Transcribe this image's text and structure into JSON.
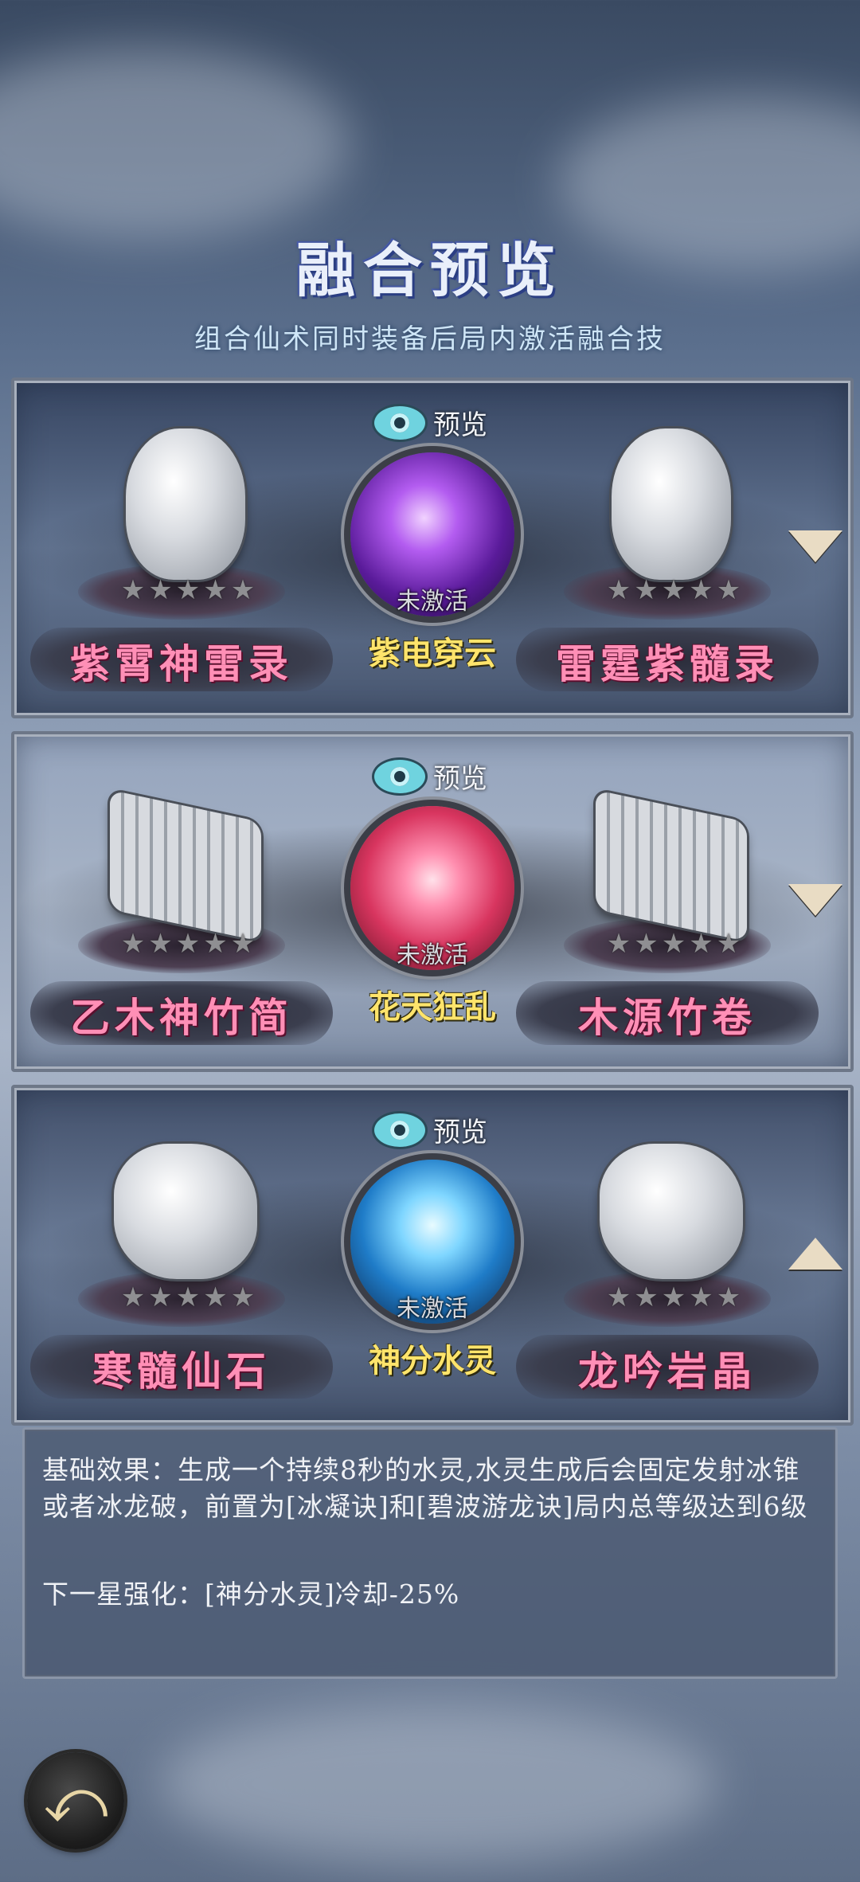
{
  "header": {
    "title": "融合预览",
    "subtitle": "组合仙术同时装备后局内激活融合技"
  },
  "fusions": [
    {
      "left": {
        "name": "紫霄神雷录",
        "stars": 5,
        "icon": "thunder-talisman-icon"
      },
      "right": {
        "name": "雷霆紫髓录",
        "stars": 5,
        "icon": "thunder-talisman-icon"
      },
      "preview_label": "预览",
      "status": "未激活",
      "fusion_name": "紫电穿云",
      "orb_color": "#7a2fd0",
      "toggle": "collapse"
    },
    {
      "left": {
        "name": "乙木神竹简",
        "stars": 5,
        "icon": "bamboo-scroll-icon"
      },
      "right": {
        "name": "木源竹卷",
        "stars": 5,
        "icon": "bamboo-scroll-icon"
      },
      "preview_label": "预览",
      "status": "未激活",
      "fusion_name": "花天狂乱",
      "orb_color": "#e0406a",
      "toggle": "collapse"
    },
    {
      "left": {
        "name": "寒髓仙石",
        "stars": 5,
        "icon": "ice-stone-icon"
      },
      "right": {
        "name": "龙吟岩晶",
        "stars": 5,
        "icon": "dragon-crystal-icon"
      },
      "preview_label": "预览",
      "status": "未激活",
      "fusion_name": "神分水灵",
      "orb_color": "#2a8ad8",
      "toggle": "expand"
    }
  ],
  "description": {
    "base_effect": "基础效果：生成一个持续8秒的水灵,水灵生成后会固定发射冰锥或者冰龙破，前置为[冰凝诀]和[碧波游龙诀]局内总等级达到6级",
    "next_star": "下一星强化：[神分水灵]冷却-25%"
  },
  "footer": {
    "back_icon": "back-arrow-icon"
  }
}
